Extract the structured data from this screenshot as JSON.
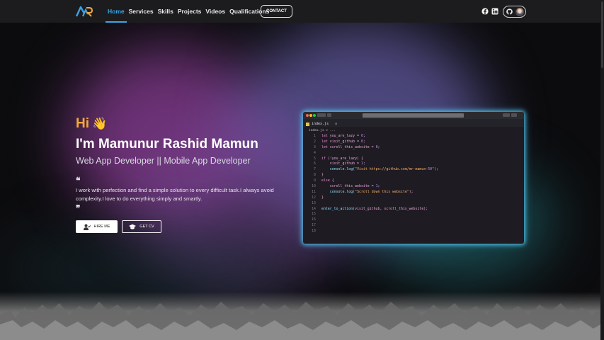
{
  "nav": {
    "links": [
      "Home",
      "Services",
      "Skills",
      "Projects",
      "Videos",
      "Qualifications"
    ],
    "active_link": "Home",
    "contact_label": "CONTACT",
    "social_icons": [
      "facebook-icon",
      "linkedin-icon"
    ],
    "theme_toggle_icon": "github-icon"
  },
  "hero": {
    "greeting": "Hi",
    "greeting_emoji": "👋",
    "name": "I'm Mamunur Rashid Mamun",
    "role": "Web App Developer || Mobile App Developer",
    "quote_open": "❝",
    "quote_close": "❞",
    "bio": "I work with perfection and find a simple solution to every difficult task.I always avoid complexity.I love to do everything simply and smartly.",
    "hire_label": "HIRE ME",
    "cv_label": "GET CV"
  },
  "editor": {
    "tab_name": "index.js",
    "breadcrumb": "index.js > ...",
    "lines": [
      {
        "n": "1",
        "text": "let you_are_lazy = 0;"
      },
      {
        "n": "2",
        "text": "let visit_github = 0;"
      },
      {
        "n": "3",
        "text": "let scroll_this_website = 0;"
      },
      {
        "n": "4",
        "text": ""
      },
      {
        "n": "5",
        "text": "if (!you_are_lazy) {"
      },
      {
        "n": "6",
        "text": "    visit_github = 1;"
      },
      {
        "n": "7",
        "text": "    console.log(\"Visit https://github.com/mr-mamun-50\");"
      },
      {
        "n": "8",
        "text": "}"
      },
      {
        "n": "9",
        "text": "else {"
      },
      {
        "n": "10",
        "text": "    scroll_this_website = 1;"
      },
      {
        "n": "11",
        "text": "    console.log(\"Scroll down this website\");"
      },
      {
        "n": "12",
        "text": "}"
      },
      {
        "n": "13",
        "text": ""
      },
      {
        "n": "14",
        "text": "enter_to_action(visit_github, scroll_this_website);"
      },
      {
        "n": "15",
        "text": ""
      },
      {
        "n": "16",
        "text": ""
      },
      {
        "n": "17",
        "text": ""
      },
      {
        "n": "18",
        "text": ""
      }
    ]
  },
  "colors": {
    "accent_blue": "#37a8e6",
    "greeting_orange": "#f2a93b",
    "editor_glow": "#55d2ff"
  }
}
